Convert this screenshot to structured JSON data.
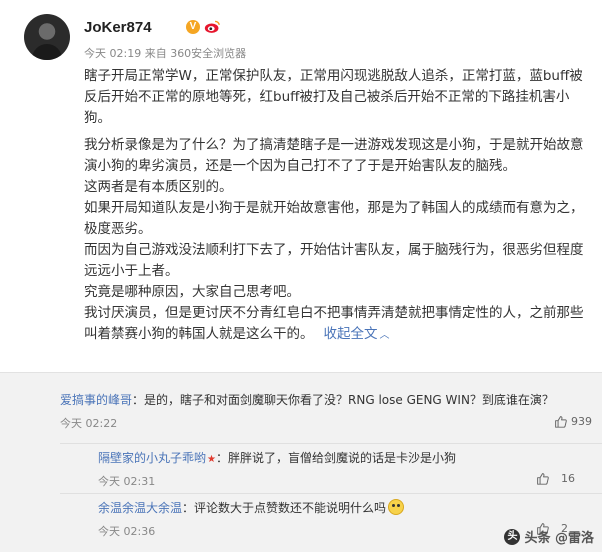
{
  "post": {
    "username": "JoKer874",
    "verified_badge": "V",
    "icons": {
      "verified": "verified-badge-icon",
      "weibo": "weibo-icon"
    },
    "meta": "今天 02:19 来自 360安全浏览器",
    "paragraphs": [
      "瞎子开局正常学W，正常保护队友，正常用闪现逃脱敌人追杀，正常打蓝，蓝buff被反后开始不正常的原地等死，红buff被打及自己被杀后开始不正常的下路挂机害小狗。",
      "我分析录像是为了什么？为了搞清楚瞎子是一进游戏发现这是小狗，于是就开始故意演小狗的卑劣演员，还是一个因为自己打不了了于是开始害队友的脑残。",
      "这两者是有本质区别的。",
      "如果开局知道队友是小狗于是就开始故意害他，那是为了韩国人的成绩而有意为之，极度恶劣。",
      "而因为自己游戏没法顺利打下去了，开始估计害队友，属于脑残行为，很恶劣但程度远远小于上者。",
      "究竟是哪种原因，大家自己思考吧。",
      "我讨厌演员，但是更讨厌不分青红皂白不把事情弄清楚就把事情定性的人，之前那些叫着禁赛小狗的韩国人就是这么干的。"
    ],
    "collapse_label": "收起全文",
    "collapse_chevron": "︿"
  },
  "comments": [
    {
      "author": "爱搞事的峰哥",
      "text": "：是的，瞎子和对面剑魔聊天你看了没？RNG lose GENG WIN？到底谁在演？",
      "time": "今天 02:22",
      "likes": "939",
      "flag": "",
      "emoji": false
    },
    {
      "author": "隔壁家的小丸子乖哟",
      "text": "：胖胖说了，盲僧给剑魔说的话是卡沙是小狗",
      "time": "今天 02:31",
      "likes": "16",
      "flag": "★",
      "emoji": false
    },
    {
      "author": "余温余温大余温",
      "text": "：评论数大于点赞数还不能说明什么吗",
      "time": "今天 02:36",
      "likes": "2",
      "flag": "",
      "emoji": true
    }
  ],
  "watermark": {
    "logo": "头",
    "text": "头条 @雷洛"
  }
}
